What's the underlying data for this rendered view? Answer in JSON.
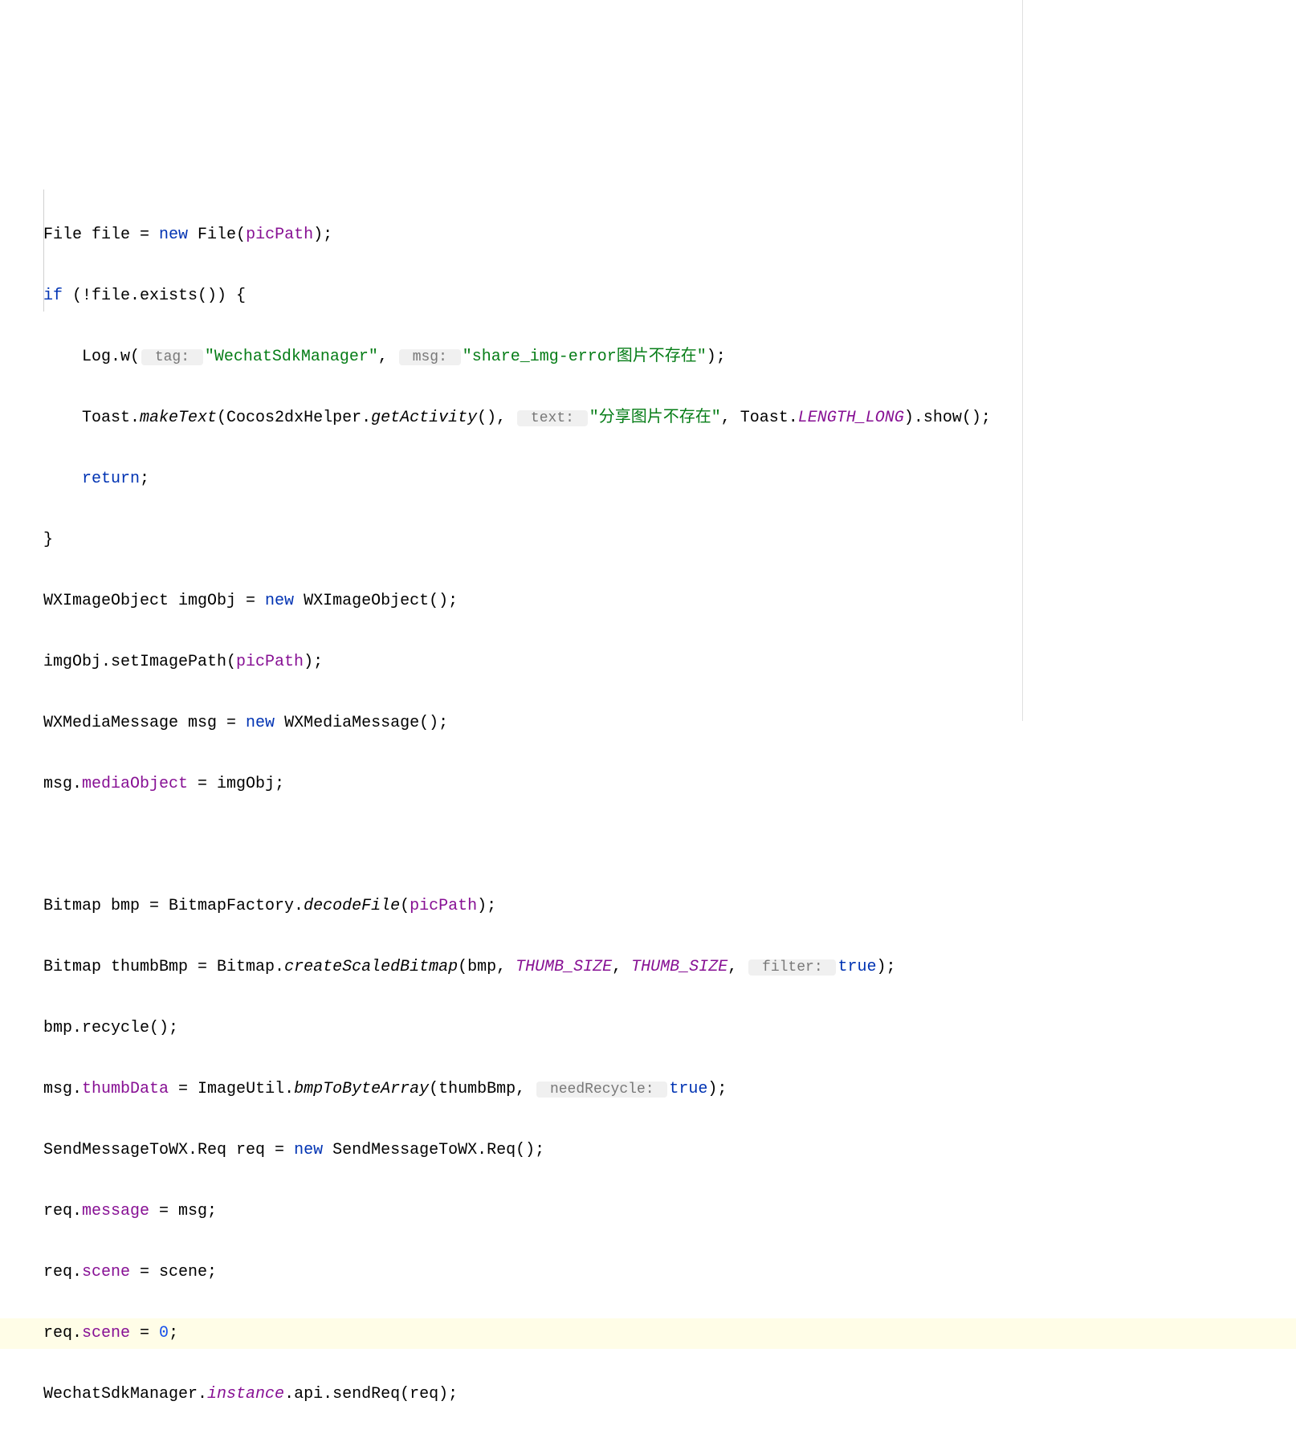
{
  "code": {
    "line1_part1": "File file = ",
    "line1_new": "new",
    "line1_part2": " File(",
    "line1_picPath": "picPath",
    "line1_part3": ");",
    "line2_if": "if",
    "line2_part1": " (!file.exists()) {",
    "line3_part1": "    Log.w(",
    "line3_hint1": " tag: ",
    "line3_str1": "\"WechatSdkManager\"",
    "line3_comma": ", ",
    "line3_hint2": " msg: ",
    "line3_str2": "\"share_img-error图片不存在\"",
    "line3_end": ");",
    "line4_part1": "    Toast.",
    "line4_makeText": "makeText",
    "line4_part2": "(Cocos2dxHelper.",
    "line4_getActivity": "getActivity",
    "line4_part3": "(), ",
    "line4_hint": " text: ",
    "line4_str": "\"分享图片不存在\"",
    "line4_comma": ", Toast.",
    "line4_length": "LENGTH_LONG",
    "line4_end": ").show();",
    "line5_return": "return",
    "line5_semi": ";",
    "line6": "}",
    "line7_part1": "WXImageObject imgObj = ",
    "line7_new": "new",
    "line7_part2": " WXImageObject();",
    "line8_part1": "imgObj.setImagePath(",
    "line8_picPath": "picPath",
    "line8_end": ");",
    "line9_part1": "WXMediaMessage msg = ",
    "line9_new": "new",
    "line9_part2": " WXMediaMessage();",
    "line10_part1": "msg.",
    "line10_mediaObject": "mediaObject",
    "line10_part2": " = imgObj;",
    "line11": "",
    "line12_part1": "Bitmap bmp = BitmapFactory.",
    "line12_decodeFile": "decodeFile",
    "line12_part2": "(",
    "line12_picPath": "picPath",
    "line12_end": ");",
    "line13_part1": "Bitmap thumbBmp = Bitmap.",
    "line13_createScaled": "createScaledBitmap",
    "line13_part2": "(bmp, ",
    "line13_thumb1": "THUMB_SIZE",
    "line13_comma1": ", ",
    "line13_thumb2": "THUMB_SIZE",
    "line13_comma2": ", ",
    "line13_hint": " filter: ",
    "line13_true": "true",
    "line13_end": ");",
    "line14": "bmp.recycle();",
    "line15_part1": "msg.",
    "line15_thumbData": "thumbData",
    "line15_part2": " = ImageUtil.",
    "line15_bmp": "bmpToByteArray",
    "line15_part3": "(thumbBmp, ",
    "line15_hint": " needRecycle: ",
    "line15_true": "true",
    "line15_end": ");",
    "line16_part1": "SendMessageToWX.Req req = ",
    "line16_new": "new",
    "line16_part2": " SendMessageToWX.Req();",
    "line17_part1": "req.",
    "line17_message": "message",
    "line17_part2": " = msg;",
    "line18_part1": "req.",
    "line18_scene": "scene",
    "line18_part2": " = scene;",
    "line19_part1": "req.",
    "line19_scene": "scene",
    "line19_part2": " = ",
    "line19_zero": "0",
    "line19_semi": ";",
    "line20_part1": "WechatSdkManager.",
    "line20_instance": "instance",
    "line20_part2": ".api.sendReq(req);"
  }
}
